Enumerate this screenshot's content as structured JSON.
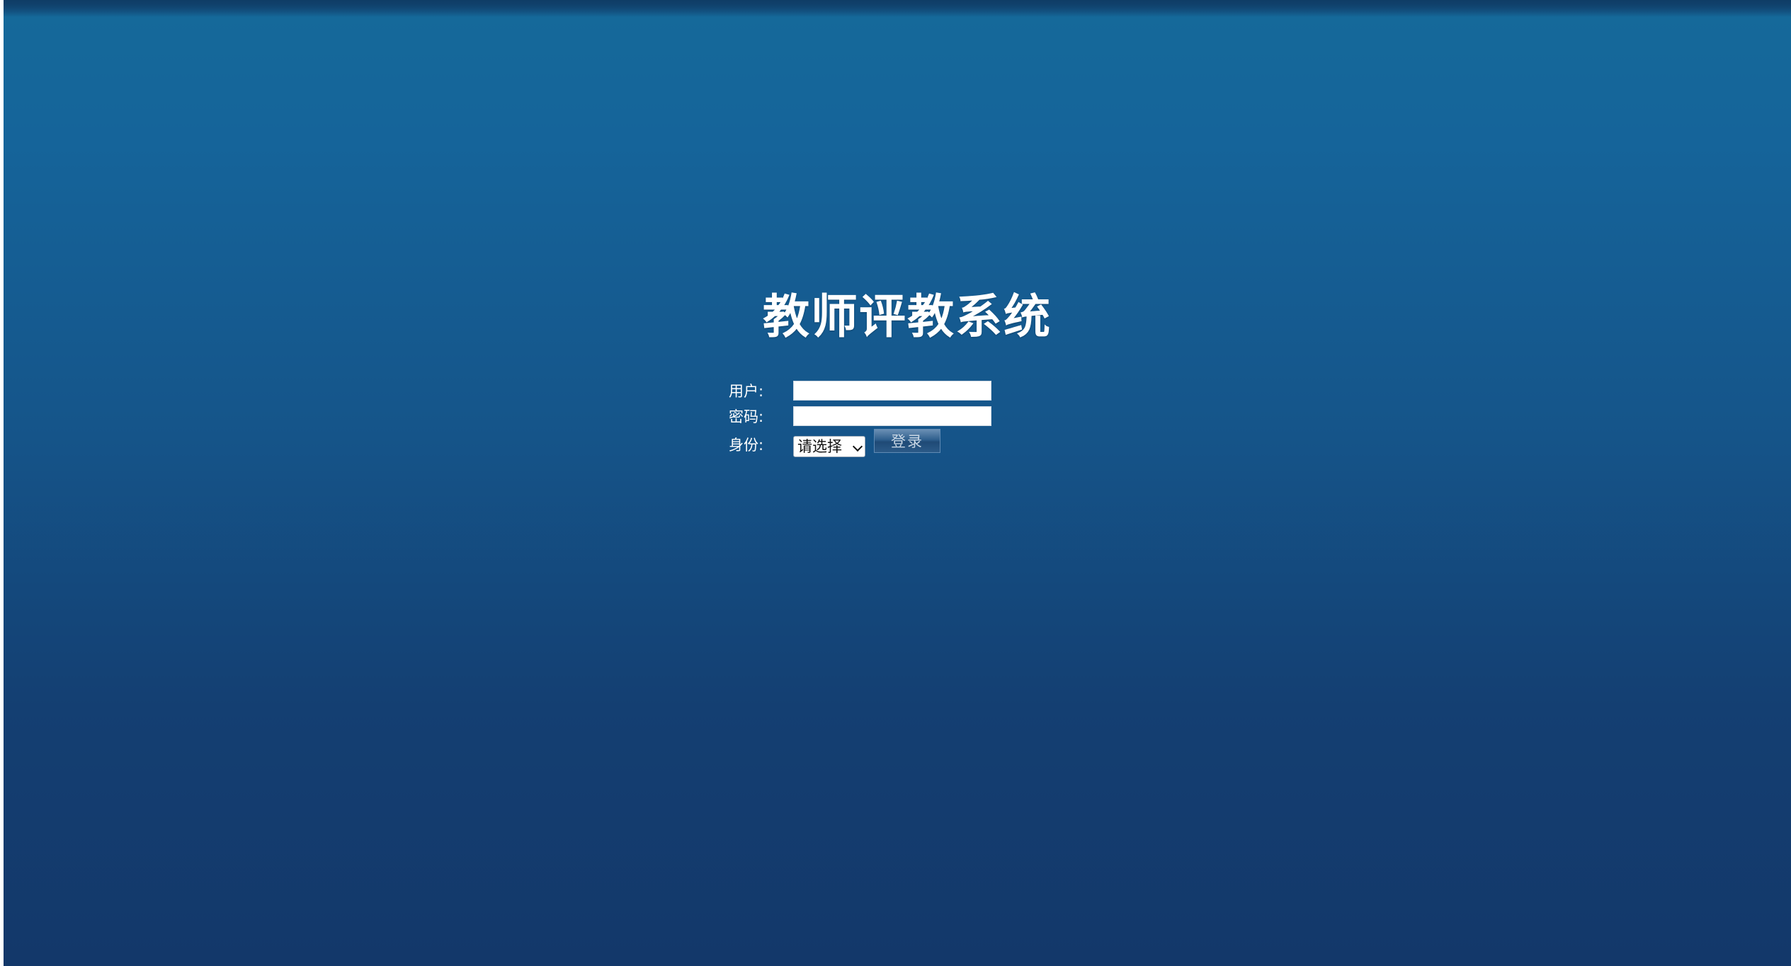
{
  "page": {
    "title": "教师评教系统"
  },
  "form": {
    "username_label": "用户:",
    "username_value": "",
    "password_label": "密码:",
    "password_value": "",
    "role_label": "身份:",
    "role_selected": "请选择",
    "login_label": "登录"
  },
  "colors": {
    "background_top": "#15699a",
    "background_bottom": "#13386a",
    "text": "#ffffff"
  }
}
